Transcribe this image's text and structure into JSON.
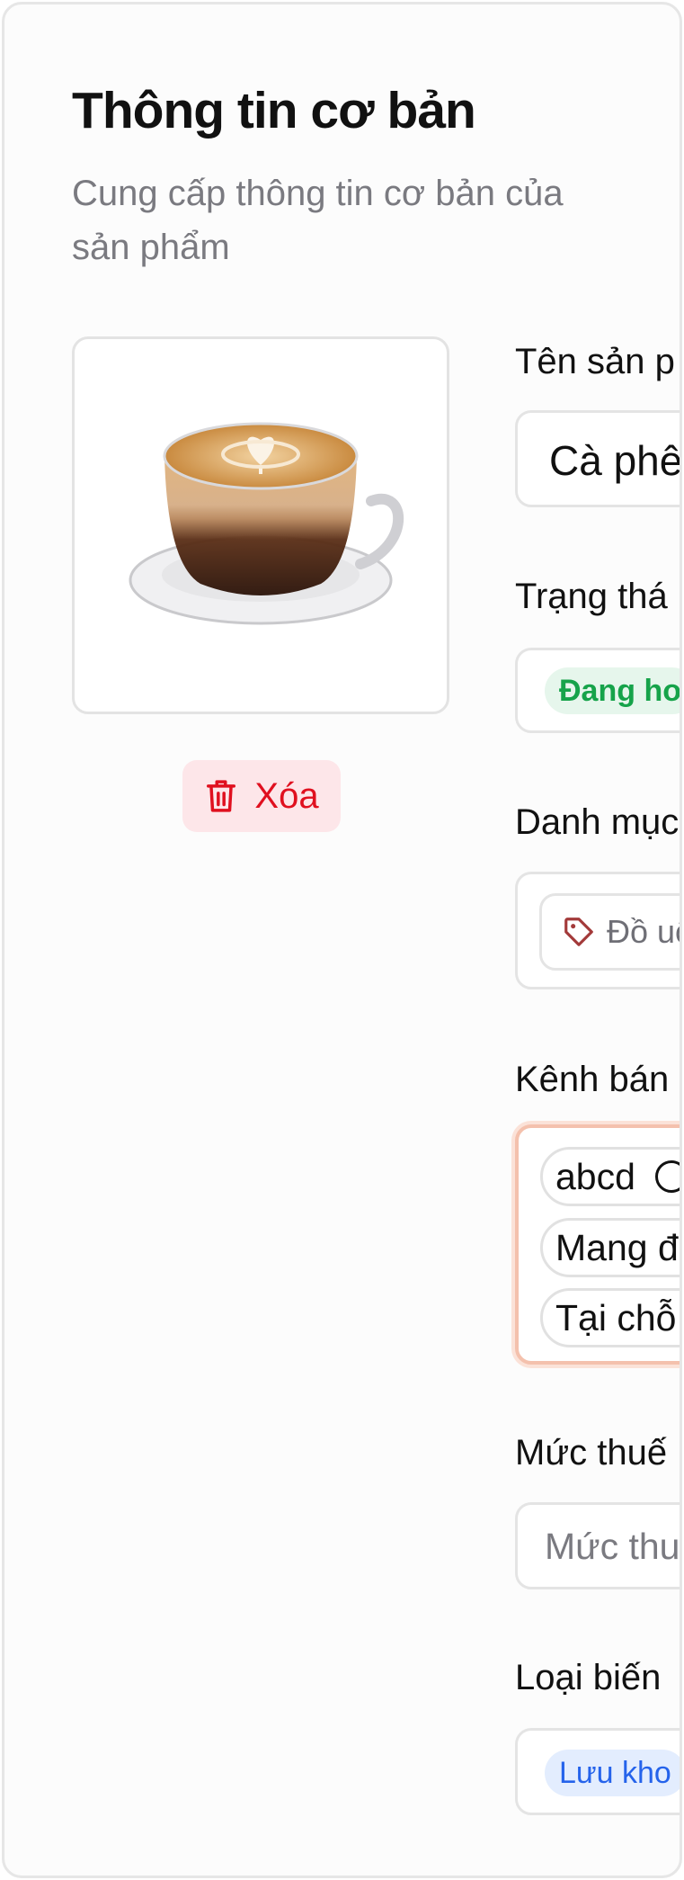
{
  "section": {
    "title": "Thông tin cơ bản",
    "subtitle": "Cung cấp thông tin cơ bản của sản phẩm"
  },
  "image": {
    "alt": "cappuccino-cup-image",
    "delete_label": "Xóa"
  },
  "fields": {
    "product_name": {
      "label": "Tên sản p",
      "value": "Cà phê"
    },
    "status": {
      "label": "Trạng thá",
      "badge": "Đang ho"
    },
    "category": {
      "label": "Danh mục",
      "tag": "Đồ uố"
    },
    "sales_channel": {
      "label": "Kênh bán",
      "chips": [
        "abcd",
        "Mang đ",
        "Tại chỗ"
      ]
    },
    "tax": {
      "label": "Mức thuế",
      "placeholder": "Mức thu"
    },
    "variant_type": {
      "label": "Loại biến",
      "badge": "Lưu kho"
    }
  },
  "colors": {
    "delete": "#e0101f",
    "status_green": "#16a34a",
    "variant_blue": "#2563eb",
    "focus_ring": "#f4c1ad"
  },
  "icons": {
    "delete": "trash-icon",
    "category": "tag-icon",
    "chip_remove": "close-circle-icon"
  }
}
